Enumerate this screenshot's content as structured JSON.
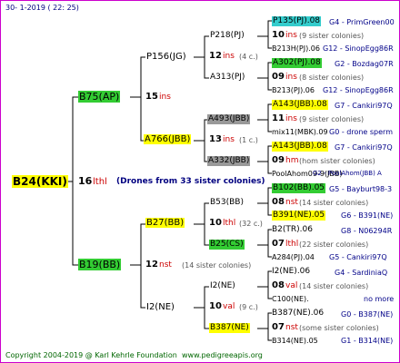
{
  "timestamp": "30-   1-2019  (  22:  25)",
  "footer": {
    "copyright": "Copyright 2004-2019 @ Karl Kehrle Foundation",
    "url": "www.pedigreeapis.org"
  },
  "root": {
    "id": "B24(KKI)",
    "gen": "16",
    "ins": "lthl",
    "note": "(Drones from 33 sister colonies)"
  },
  "l1": [
    {
      "id": "B75(AP)",
      "gen": "15",
      "ins": "ins"
    },
    {
      "id": "B19(BB)",
      "gen": "12",
      "ins": "nst",
      "note": "(14 sister colonies)"
    }
  ],
  "l2": [
    {
      "id": "P156(JG)",
      "gen": "12",
      "ins": "ins",
      "note": "(4 c.)"
    },
    {
      "id": "A766(JBB)",
      "gen": "13",
      "ins": "ins",
      "note": "(1 c.)"
    },
    {
      "id": "B27(BB)",
      "gen": "10",
      "ins": "lthl",
      "note": "(32 c.)"
    },
    {
      "id": "I2(NE)",
      "gen": "10",
      "ins": "val",
      "note": "(9 c.)"
    }
  ],
  "l3": [
    {
      "id": "P218(PJ)"
    },
    {
      "id": "A313(PJ)"
    },
    {
      "id": "A493(JBB)"
    },
    {
      "id": "A332(JBB)"
    },
    {
      "id": "B53(BB)"
    },
    {
      "id": "B25(CS)"
    },
    {
      "id": "I2(NE)"
    },
    {
      "id": "B387(NE)"
    }
  ],
  "l4": [
    {
      "top": "P135(PJ).08",
      "topr": "G4 - PrimGreen00",
      "mid_n": "10",
      "mid_i": "ins",
      "mid_t": "(9 sister colonies)",
      "bot": "B213H(PJ).06",
      "botr": "G12 - SinopEgg86R"
    },
    {
      "top": "A302(PJ).08",
      "topr": "G2 - Bozdag07R",
      "mid_n": "09",
      "mid_i": "ins",
      "mid_t": "(8 sister colonies)",
      "bot": "B213(PJ).06",
      "botr": "G12 - SinopEgg86R"
    },
    {
      "top": "A143(JBB).08",
      "topr": "G7 - Cankiri97Q",
      "mid_n": "11",
      "mid_i": "ins",
      "mid_t": "(9 sister colonies)",
      "bot": "mix11(MBK).09",
      "botr": "G0 - drone sperm"
    },
    {
      "top": "A143(JBB).08",
      "topr": "G7 - Cankiri97Q",
      "mid_n": "09",
      "mid_i": "hm",
      "mid_t": "(hom sister colonies)",
      "bot": "PoolAhom09-9(JBB)",
      "botr": "G2 - PoolAhom(JBB) A"
    },
    {
      "top": "B102(BB).05",
      "topr": "G5 - Bayburt98-3",
      "mid_n": "08",
      "mid_i": "nst",
      "mid_t": "(14 sister colonies)",
      "bot": "B391(NE).05",
      "botr": "G6 - B391(NE)"
    },
    {
      "top": "B2(TR).06",
      "topr": "G8 - N06294R",
      "mid_n": "07",
      "mid_i": "lthl",
      "mid_t": "(22 sister colonies)",
      "bot": "A284(PJ).04",
      "botr": "G5 - Cankiri97Q"
    },
    {
      "top": "I2(NE).06",
      "topr": "G4 - SardiniaQ",
      "mid_n": "08",
      "mid_i": "val",
      "mid_t": "(14 sister colonies)",
      "bot": "C100(NE).",
      "botr": "no more"
    },
    {
      "top": "B387(NE).06",
      "topr": "G0 - B387(NE)",
      "mid_n": "07",
      "mid_i": "nst",
      "mid_t": "(some sister colonies)",
      "bot": "B314(NE).05",
      "botr": "G1 - B314(NE)"
    }
  ],
  "colors": {
    "border": "#cc00cc",
    "line": "#000000",
    "yellow": "#ffff00",
    "green": "#33cc33",
    "cyan": "#33cccc",
    "gray": "#999999",
    "footer": "#006600"
  }
}
